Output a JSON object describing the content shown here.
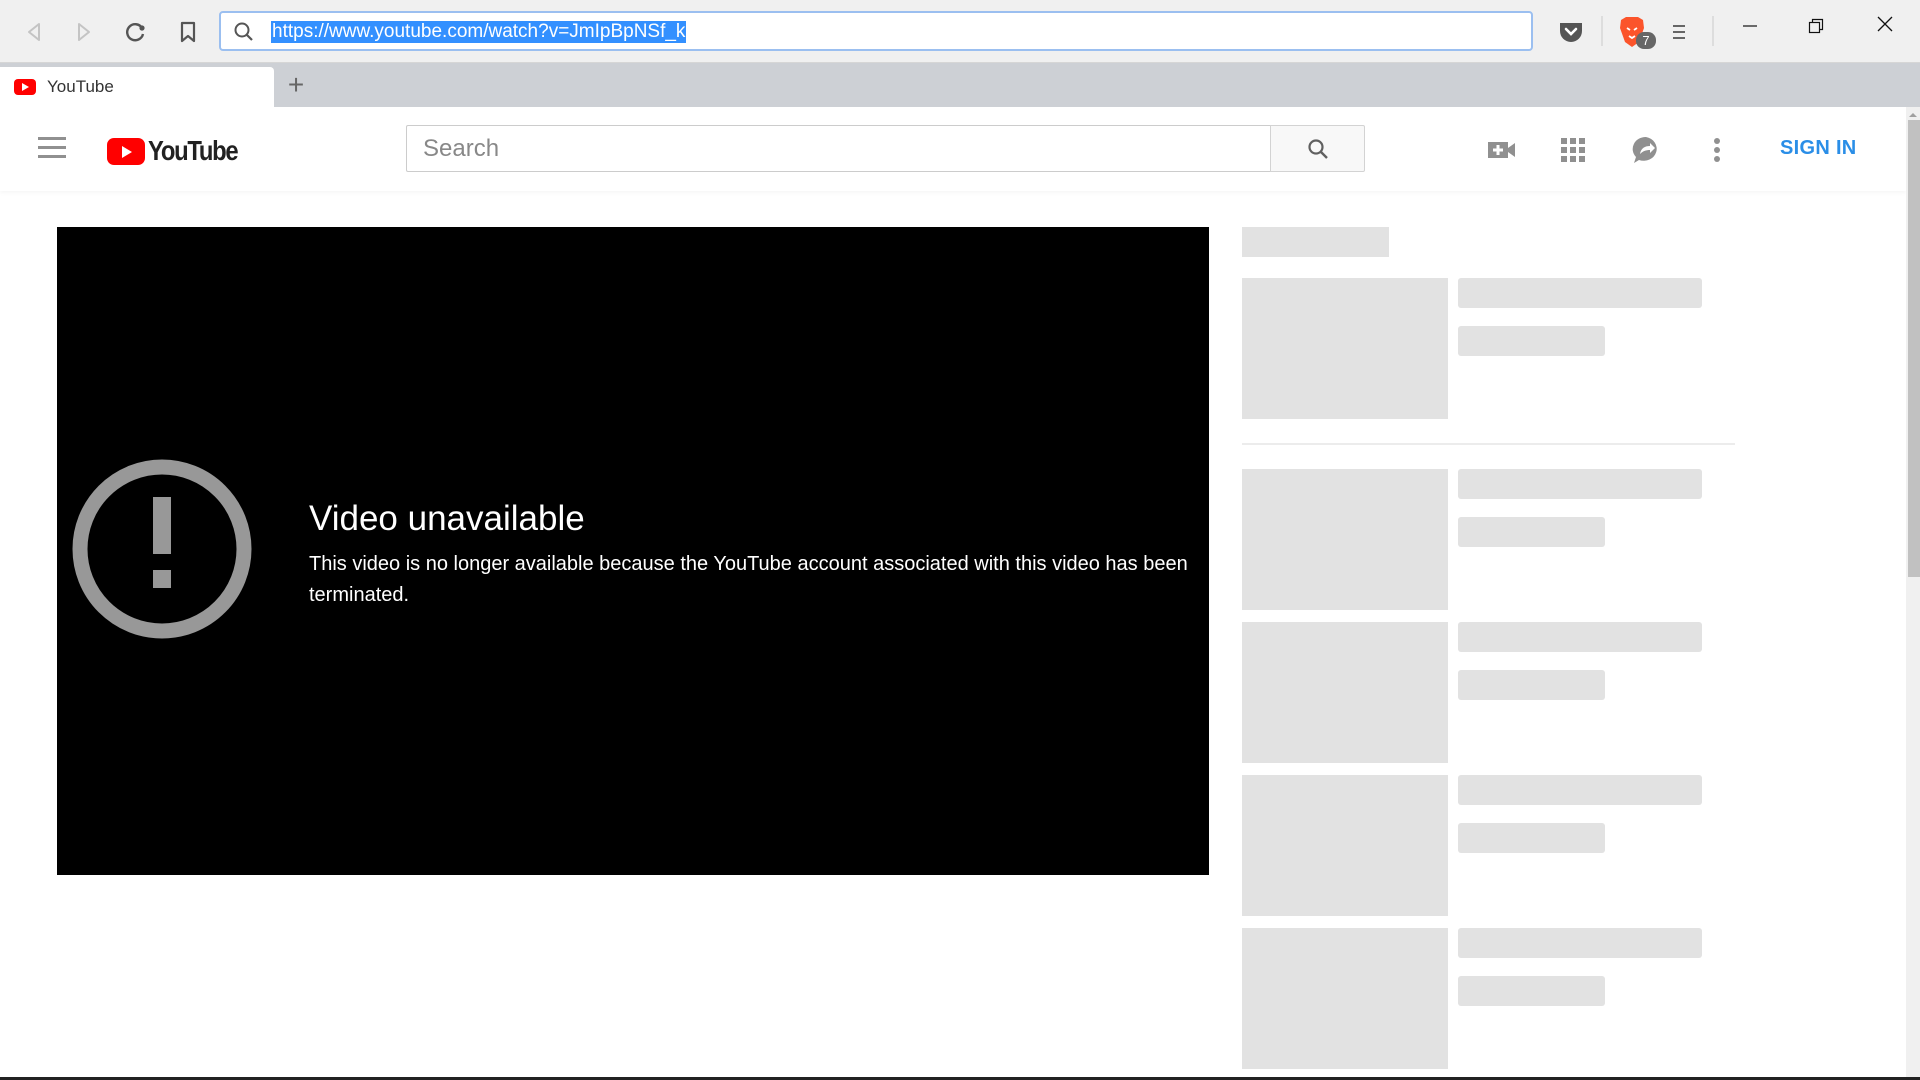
{
  "browser": {
    "url": "https://www.youtube.com/watch?v=JmIpBpNSf_k",
    "tab_title": "YouTube",
    "new_tab_label": "+",
    "shield_badge_count": "7",
    "icons": {
      "back": "back-arrow-icon",
      "forward": "forward-arrow-icon",
      "reload": "reload-icon",
      "bookmark": "bookmark-icon",
      "search": "search-icon",
      "pocket": "pocket-icon",
      "shields": "brave-lion-icon",
      "menu": "hamburger-menu-icon",
      "minimize": "minimize-icon",
      "restore": "restore-icon",
      "close": "close-icon"
    }
  },
  "youtube": {
    "logo_text": "YouTube",
    "search_placeholder": "Search",
    "sign_in_label": "SIGN IN",
    "brand_color": "#ff0000",
    "link_color": "#2a8ee7",
    "icons": [
      "create-video-icon",
      "apps-grid-icon",
      "messages-icon",
      "more-vert-icon"
    ]
  },
  "player": {
    "error_title": "Video unavailable",
    "error_message": "This video is no longer available because the YouTube account associated with this video has been terminated.",
    "error_icon": "alert-circle-icon"
  },
  "sidebar": {
    "placeholder_items": 5
  }
}
